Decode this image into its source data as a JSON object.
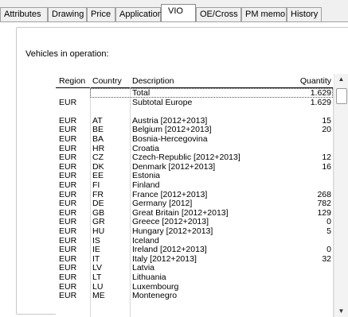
{
  "tabs": [
    {
      "label": "Attributes",
      "active": false
    },
    {
      "label": "Drawing",
      "active": false
    },
    {
      "label": "Price",
      "active": false
    },
    {
      "label": "Application",
      "active": false
    },
    {
      "label": "VIO",
      "active": true
    },
    {
      "label": "OE/Cross",
      "active": false
    },
    {
      "label": "PM memo",
      "active": false
    },
    {
      "label": "History",
      "active": false
    }
  ],
  "group": {
    "label": "Vehicles in operation:"
  },
  "grid": {
    "headers": {
      "region": "Region",
      "country": "Country",
      "description": "Description",
      "quantity": "Quantity"
    },
    "rows": [
      {
        "region": "",
        "country": "",
        "description": "Total",
        "quantity": "1.629"
      },
      {
        "region": "EUR",
        "country": "",
        "description": "Subtotal Europe",
        "quantity": "1.629"
      },
      {
        "region": "",
        "country": "",
        "description": "",
        "quantity": ""
      },
      {
        "region": "EUR",
        "country": "AT",
        "description": "Austria [2012+2013]",
        "quantity": "15"
      },
      {
        "region": "EUR",
        "country": "BE",
        "description": "Belgium [2012+2013]",
        "quantity": "20"
      },
      {
        "region": "EUR",
        "country": "BA",
        "description": "Bosnia-Hercegovina",
        "quantity": ""
      },
      {
        "region": "EUR",
        "country": "HR",
        "description": "Croatia",
        "quantity": ""
      },
      {
        "region": "EUR",
        "country": "CZ",
        "description": "Czech-Republic [2012+2013]",
        "quantity": "12"
      },
      {
        "region": "EUR",
        "country": "DK",
        "description": "Denmark [2012+2013]",
        "quantity": "16"
      },
      {
        "region": "EUR",
        "country": "EE",
        "description": "Estonia",
        "quantity": ""
      },
      {
        "region": "EUR",
        "country": "FI",
        "description": "Finland",
        "quantity": ""
      },
      {
        "region": "EUR",
        "country": "FR",
        "description": "France [2012+2013]",
        "quantity": "268"
      },
      {
        "region": "EUR",
        "country": "DE",
        "description": "Germany [2012]",
        "quantity": "782"
      },
      {
        "region": "EUR",
        "country": "GB",
        "description": "Great Britain [2012+2013]",
        "quantity": "129"
      },
      {
        "region": "EUR",
        "country": "GR",
        "description": "Greece [2012+2013]",
        "quantity": "0"
      },
      {
        "region": "EUR",
        "country": "HU",
        "description": "Hungary [2012+2013]",
        "quantity": "5"
      },
      {
        "region": "EUR",
        "country": "IS",
        "description": "Iceland",
        "quantity": ""
      },
      {
        "region": "EUR",
        "country": "IE",
        "description": "Ireland [2012+2013]",
        "quantity": "0"
      },
      {
        "region": "EUR",
        "country": "IT",
        "description": "Italy [2012+2013]",
        "quantity": "32"
      },
      {
        "region": "EUR",
        "country": "LV",
        "description": "Latvia",
        "quantity": ""
      },
      {
        "region": "EUR",
        "country": "LT",
        "description": "Lithuania",
        "quantity": ""
      },
      {
        "region": "EUR",
        "country": "LU",
        "description": "Luxembourg",
        "quantity": ""
      },
      {
        "region": "EUR",
        "country": "ME",
        "description": "Montenegro",
        "quantity": ""
      }
    ]
  },
  "scrollbar": {
    "up_icon": "scroll-up-arrow-icon",
    "down_icon": "scroll-down-arrow-icon"
  }
}
